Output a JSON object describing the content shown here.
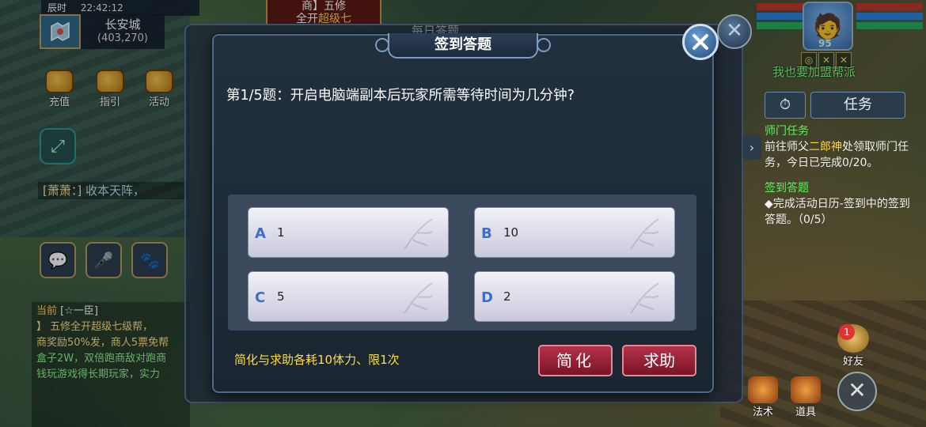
{
  "hud": {
    "time_label": "辰时",
    "time": "22:42:12",
    "city": "长安城",
    "coords": "(403,270)",
    "buttons": [
      {
        "label": "充值",
        "icon": "gift-icon"
      },
      {
        "label": "指引",
        "icon": "guide-icon"
      },
      {
        "label": "活动",
        "icon": "activity-icon"
      }
    ],
    "chat_speaker": "[萧萧：]",
    "chat_text": "收本天阵，",
    "chat_panel": {
      "current_tag": "当前",
      "current_name": "[☆一臣]",
      "line1": "】 五修全开超级七级帮，",
      "line2": "商奖励50%发，商人5票免帮",
      "line3": "盒子2W，双倍跑商敌对跑商",
      "line4": "钱玩游戏得长期玩家，实力"
    }
  },
  "top_banner": {
    "line1": "商】五修",
    "line2_pre": "全开",
    "line2_hl": "超级七"
  },
  "behind": {
    "title": "每日答题"
  },
  "right_hud": {
    "level": "95",
    "hint": "我也要加盟帮派",
    "task_tab": "任务",
    "tasks": [
      {
        "title": "师门任务",
        "body_pre": "前往师父",
        "body_hl": "二郎神",
        "body_post": "处领取师门任务，今日已完成0/20。"
      },
      {
        "title": "签到答题",
        "body_pre": "◆完成活动日历-签到中的签到答题。（0/5）",
        "body_hl": "",
        "body_post": ""
      }
    ],
    "friend_label": "好友",
    "friend_badge": "1",
    "bottom_buttons": [
      {
        "label": "法术"
      },
      {
        "label": "道具"
      }
    ]
  },
  "dialog": {
    "title": "签到答题",
    "question": "第1/5题：开启电脑端副本后玩家所需等待时间为几分钟?",
    "options": [
      {
        "letter": "A",
        "value": "1"
      },
      {
        "letter": "B",
        "value": "10"
      },
      {
        "letter": "C",
        "value": "5"
      },
      {
        "letter": "D",
        "value": "2"
      }
    ],
    "tip": "简化与求助各耗10体力、限1次",
    "simplify_label": "简化",
    "help_label": "求助"
  },
  "colors": {
    "accent_yellow": "#ffdf3a",
    "button_red": "#9a1f33",
    "option_letter": "#3d6fc6",
    "task_green": "#5ef05e"
  }
}
